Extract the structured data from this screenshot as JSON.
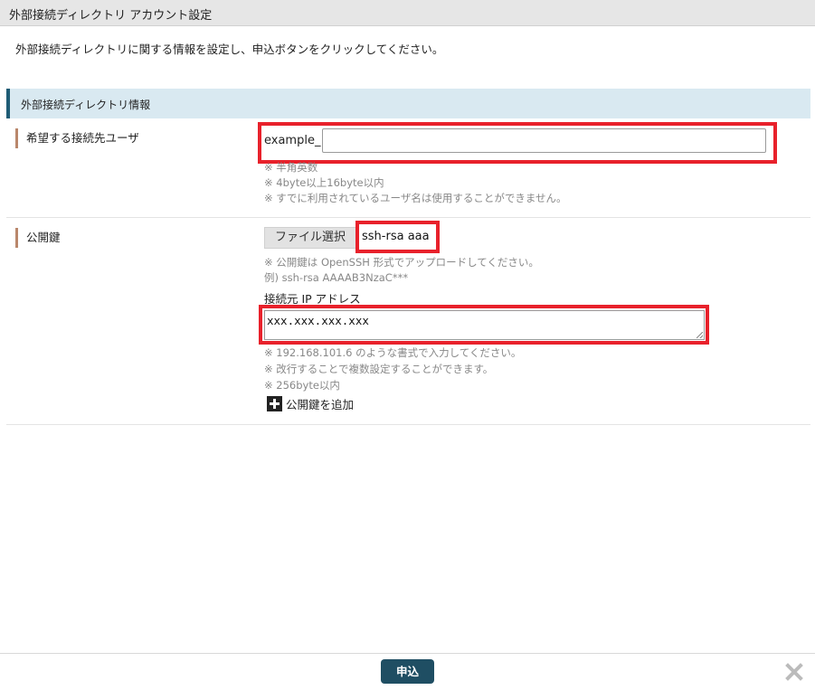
{
  "window": {
    "title": "外部接続ディレクトリ アカウント設定"
  },
  "intro": "外部接続ディレクトリに関する情報を設定し、申込ボタンをクリックしてください。",
  "section": {
    "title": "外部接続ディレクトリ情報"
  },
  "user_field": {
    "label": "希望する接続先ユーザ",
    "prefix": "example_",
    "value": "",
    "notes": [
      "※ 半角英数",
      "※ 4byte以上16byte以内",
      "※ すでに利用されているユーザ名は使用することができません。"
    ]
  },
  "public_key": {
    "label": "公開鍵",
    "file_button_label": "ファイル選択",
    "file_name": "ssh-rsa aaa",
    "notes": [
      "※ 公開鍵は OpenSSH 形式でアップロードしてください。",
      "例) ssh-rsa AAAAB3NzaC***"
    ],
    "ip_label": "接続元 IP アドレス",
    "ip_value": "xxx.xxx.xxx.xxx",
    "ip_notes": [
      "※ 192.168.101.6 のような書式で入力してください。",
      "※ 改行することで複数設定することができます。",
      "※ 256byte以内"
    ],
    "add_key_label": "公開鍵を追加"
  },
  "footer": {
    "submit_label": "申込"
  },
  "colors": {
    "highlight": "#e8212b",
    "submit_bg": "#1f4e63",
    "section_bg": "#d9e9f1"
  },
  "icons": {
    "add": "plus-icon",
    "close": "close-icon"
  }
}
